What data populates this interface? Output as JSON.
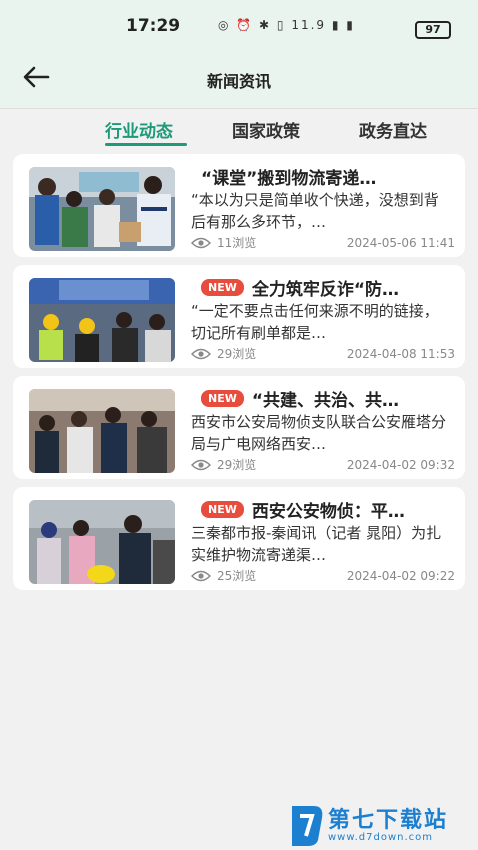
{
  "status_bar": {
    "time": "17:29",
    "icons_text": "◎ ⏰ ✱ ▯ 11.9 ▮ ▮",
    "battery": "97"
  },
  "header": {
    "title": "新闻资讯",
    "back_icon": "arrow-left-icon"
  },
  "tabs": [
    {
      "label": "行业动态",
      "active": true
    },
    {
      "label": "国家政策",
      "active": false
    },
    {
      "label": "政务直达",
      "active": false
    }
  ],
  "articles": [
    {
      "badge": "",
      "title": "“课堂”搬到物流寄递…",
      "summary": "“本以为只是简单收个快递，没想到背后有那么多环节，…",
      "views": "11浏览",
      "date": "2024-05-06 11:41"
    },
    {
      "badge": "NEW",
      "title": "全力筑牢反诈“防…",
      "summary": "“一定不要点击任何来源不明的链接，切记所有刷单都是…",
      "views": "29浏览",
      "date": "2024-04-08 11:53"
    },
    {
      "badge": "NEW",
      "title": "“共建、共治、共…",
      "summary": "西安市公安局物侦支队联合公安雁塔分局与广电网络西安…",
      "views": "29浏览",
      "date": "2024-04-02 09:32"
    },
    {
      "badge": "NEW",
      "title": "西安公安物侦：平…",
      "summary": "三秦都市报-秦闻讯（记者 晁阳）为扎实维护物流寄递渠…",
      "views": "25浏览",
      "date": "2024-04-02 09:22"
    }
  ],
  "watermark": {
    "text": "第七下载站",
    "url": "www.d7down.com"
  },
  "colors": {
    "accent": "#1c9a7a",
    "badge": "#e74c3c",
    "header_bg": "#eaf4ef"
  }
}
